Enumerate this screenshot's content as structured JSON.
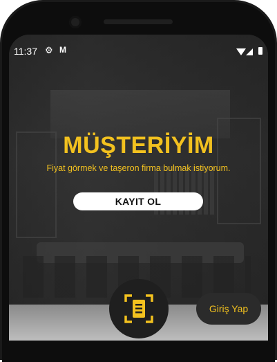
{
  "status_bar": {
    "time": "11:37",
    "icons": [
      "gear-icon",
      "gmail-icon",
      "wifi-icon",
      "signal-icon",
      "battery-icon"
    ]
  },
  "hero": {
    "title": "MÜŞTERİYİM",
    "subtitle": "Fiyat görmek ve taşeron firma bulmak istiyorum.",
    "register_label": "KAYIT OL"
  },
  "actions": {
    "scan_icon": "document-scan-icon",
    "login_label": "Giriş Yap"
  },
  "colors": {
    "accent": "#f2c11f",
    "dark_button": "#1f1f1f",
    "register_bg": "#ffffff"
  }
}
